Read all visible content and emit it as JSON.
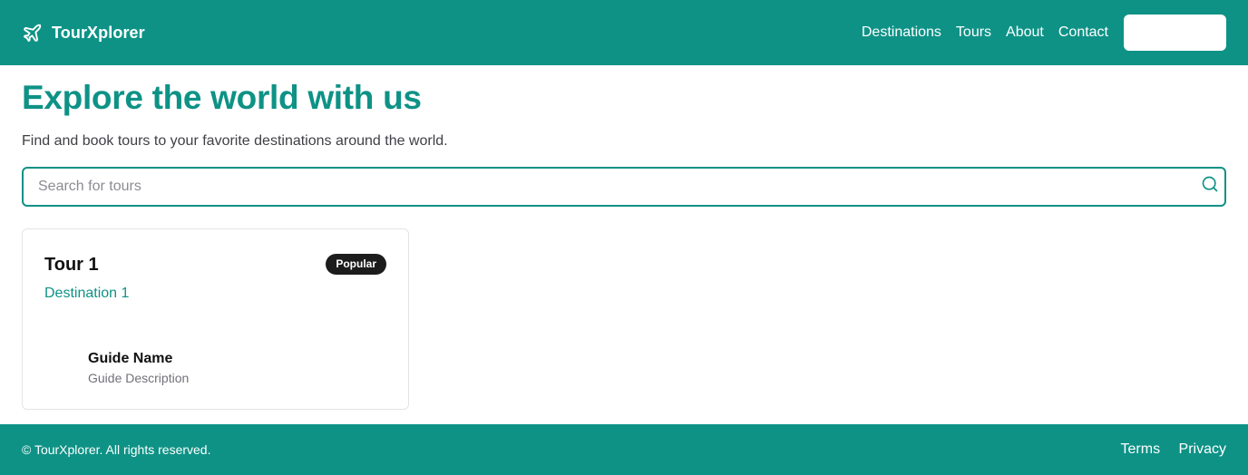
{
  "header": {
    "brand_name": "TourXplorer",
    "nav": [
      {
        "label": "Destinations"
      },
      {
        "label": "Tours"
      },
      {
        "label": "About"
      },
      {
        "label": "Contact"
      }
    ],
    "action_button_label": ""
  },
  "hero": {
    "title": "Explore the world with us",
    "subtitle": "Find and book tours to your favorite destinations around the world."
  },
  "search": {
    "placeholder": "Search for tours",
    "value": ""
  },
  "tours": [
    {
      "title": "Tour 1",
      "badge": "Popular",
      "destination": "Destination 1",
      "guide_name": "Guide Name",
      "guide_description": "Guide Description"
    }
  ],
  "footer": {
    "copyright": "© TourXplorer. All rights reserved.",
    "links": [
      {
        "label": "Terms"
      },
      {
        "label": "Privacy"
      }
    ]
  },
  "theme": {
    "primary": "#0e9286",
    "badge_bg": "#1c1c1c"
  },
  "icons": {
    "brand": "airplane-icon",
    "search": "search-icon"
  }
}
